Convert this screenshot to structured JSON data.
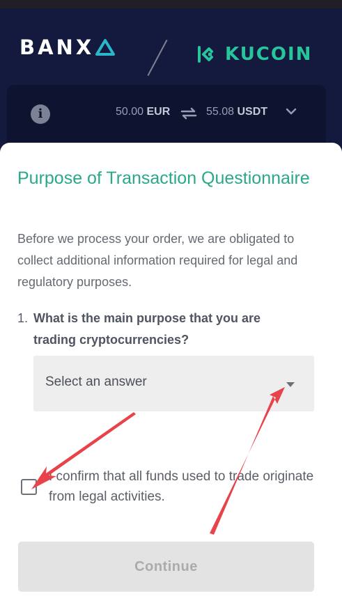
{
  "header": {
    "brand_left": "BANX",
    "brand_right": "KUCOIN"
  },
  "summary": {
    "from_amount": "50.00",
    "from_currency": "EUR",
    "to_amount": "55.08",
    "to_currency": "USDT"
  },
  "form": {
    "title": "Purpose of Transaction Questionnaire",
    "intro": "Before we process your order, we are obligated to collect additional information required for legal and regulatory purposes.",
    "question_number": "1.",
    "question_text": "What is the main purpose that you are trading cryptocurrencies?",
    "select_placeholder": "Select an answer",
    "confirm_text": "I confirm that all funds used to trade originate from legal activities.",
    "confirm_checked": false,
    "continue_label": "Continue"
  },
  "colors": {
    "header_bg": "#141a3d",
    "accent_green": "#2aa88a",
    "kucoin_green": "#26c59b",
    "banxa_triangle": "#2bb7c9",
    "annotation_red": "#e8434a"
  },
  "icons": [
    "info-icon",
    "swap-arrows-icon",
    "chevron-down-icon",
    "kucoin-logo-icon",
    "dropdown-caret-icon"
  ]
}
